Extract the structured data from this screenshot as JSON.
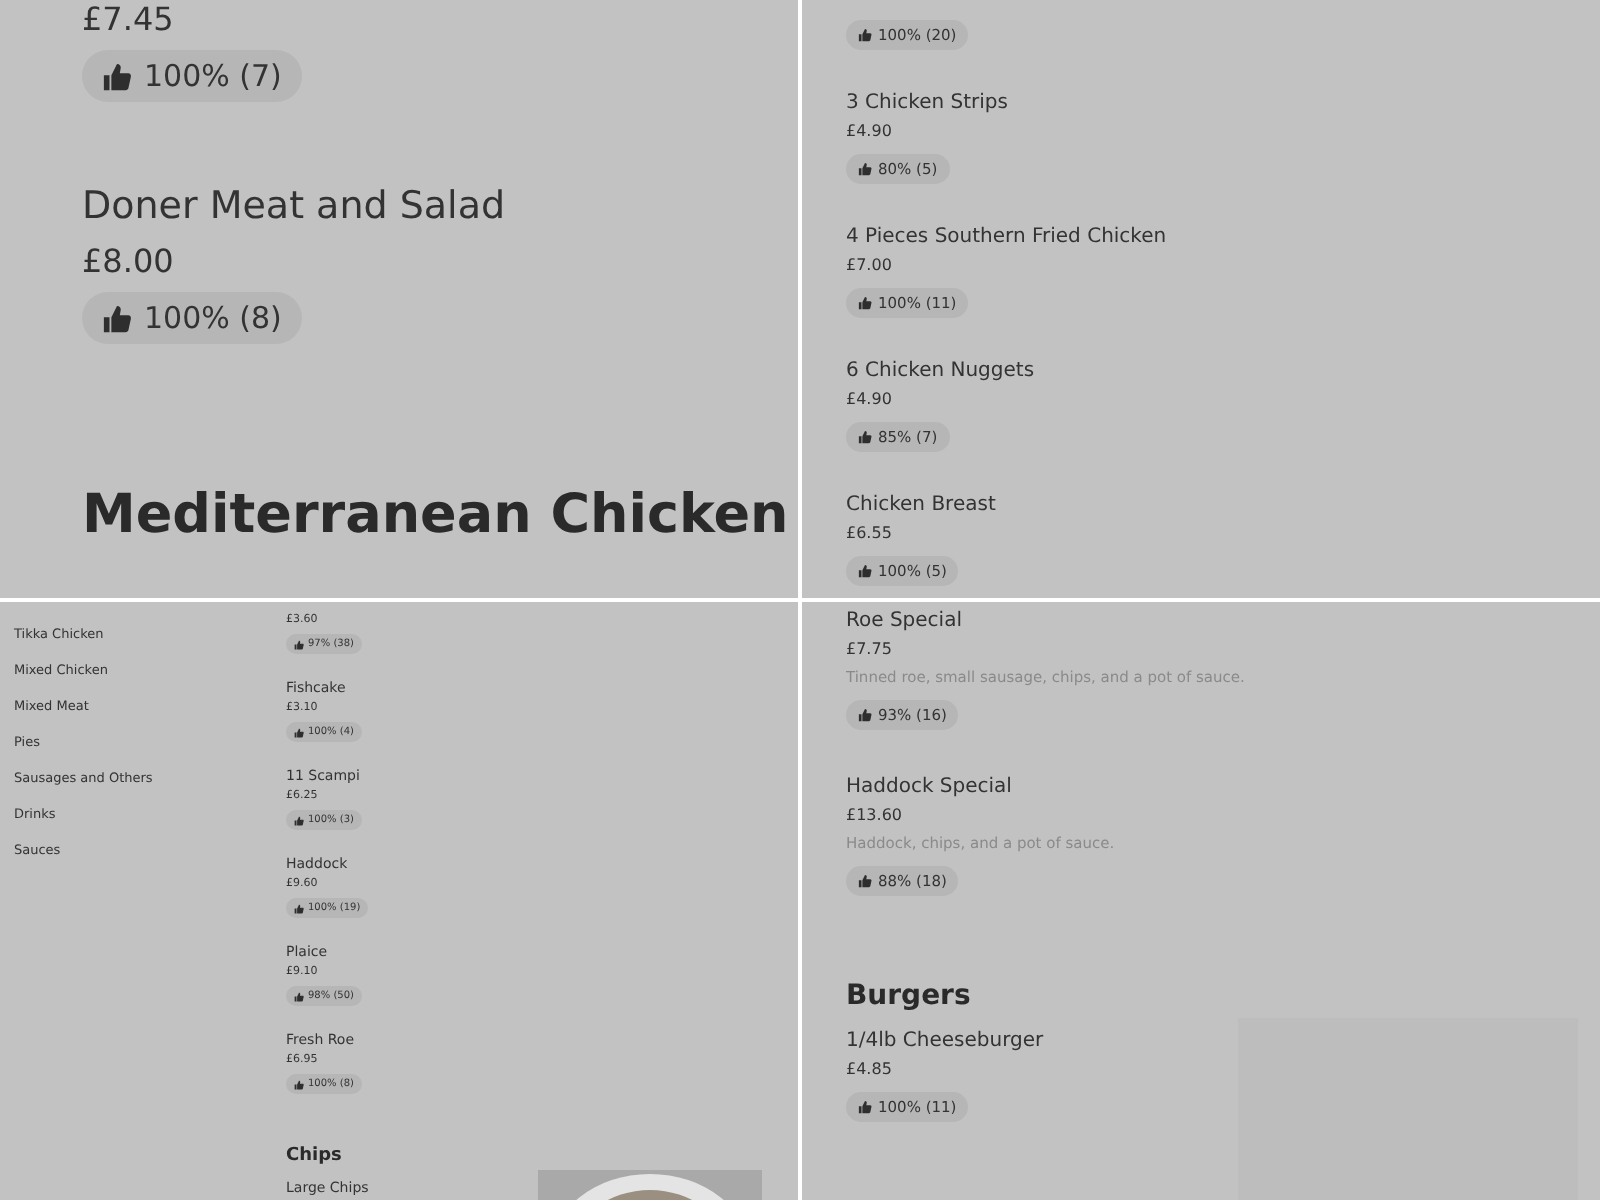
{
  "panels": [
    {
      "entries": [
        {
          "kind": "item",
          "price": "£7.45",
          "rating": "100% (7)"
        },
        {
          "kind": "item",
          "name": "Doner Meat and Salad",
          "price": "£8.00",
          "rating": "100% (8)"
        },
        {
          "kind": "heading",
          "title": "Mediterranean Chicken"
        }
      ]
    },
    {
      "entries": [
        {
          "kind": "item",
          "rating": "100% (20)"
        },
        {
          "kind": "item",
          "name": "3 Chicken Strips",
          "price": "£4.90",
          "rating": "80% (5)"
        },
        {
          "kind": "item",
          "name": "4 Pieces Southern Fried Chicken",
          "price": "£7.00",
          "rating": "100% (11)"
        },
        {
          "kind": "item",
          "name": "6 Chicken Nuggets",
          "price": "£4.90",
          "rating": "85% (7)"
        },
        {
          "kind": "item",
          "name": "Chicken Breast",
          "price": "£6.55",
          "rating": "100% (5)"
        }
      ]
    },
    {
      "sidebar": [
        "Tikka Chicken",
        "Mixed Chicken",
        "Mixed Meat",
        "Pies",
        "Sausages and Others",
        "Drinks",
        "Sauces"
      ],
      "entries": [
        {
          "kind": "item",
          "price": "£3.60",
          "rating": "97% (38)"
        },
        {
          "kind": "item",
          "name": "Fishcake",
          "price": "£3.10",
          "rating": "100% (4)"
        },
        {
          "kind": "item",
          "name": "11 Scampi",
          "price": "£6.25",
          "rating": "100% (3)"
        },
        {
          "kind": "item",
          "name": "Haddock",
          "price": "£9.60",
          "rating": "100% (19)"
        },
        {
          "kind": "item",
          "name": "Plaice",
          "price": "£9.10",
          "rating": "98% (50)"
        },
        {
          "kind": "item",
          "name": "Fresh Roe",
          "price": "£6.95",
          "rating": "100% (8)"
        },
        {
          "kind": "heading",
          "title": "Chips"
        },
        {
          "kind": "item",
          "name": "Large Chips"
        }
      ]
    },
    {
      "entries": [
        {
          "kind": "item",
          "name": "Roe Special",
          "price": "£7.75",
          "description": "Tinned roe, small sausage, chips, and a pot of sauce.",
          "rating": "93% (16)"
        },
        {
          "kind": "item",
          "name": "Haddock Special",
          "price": "£13.60",
          "description": "Haddock, chips, and a pot of sauce.",
          "rating": "88% (18)"
        },
        {
          "kind": "heading",
          "title": "Burgers"
        },
        {
          "kind": "item",
          "name": "1/4lb Cheeseburger",
          "price": "£4.85",
          "rating": "100% (11)",
          "image": {
            "kind": "empty"
          }
        }
      ]
    }
  ]
}
